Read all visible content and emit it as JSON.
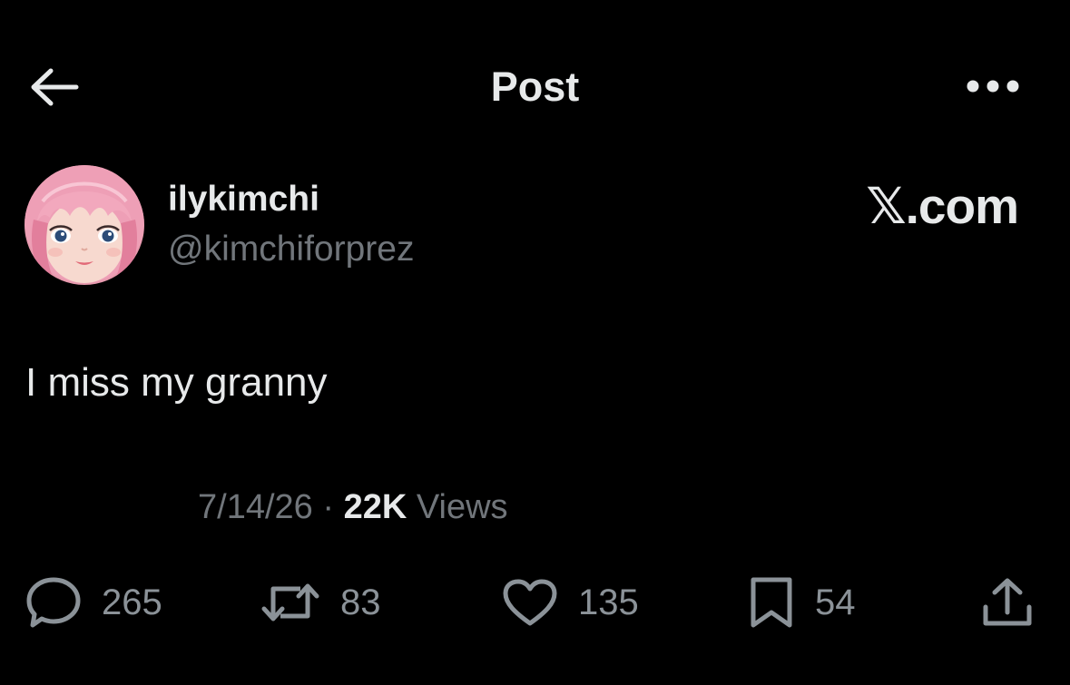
{
  "header": {
    "title": "Post",
    "back_icon": "arrow-left-icon",
    "more_icon": "more-horizontal-icon"
  },
  "author": {
    "display_name": "ilykimchi",
    "handle": "@kimchiforprez",
    "avatar_description_icon": "pink-doll-avatar"
  },
  "brand": "𝕏.com",
  "post": {
    "text": "I miss my granny",
    "date": "7/14/26",
    "separator": "·",
    "views_count": "22K",
    "views_label": "Views"
  },
  "actions": {
    "reply_count": "265",
    "repost_count": "83",
    "like_count": "135",
    "bookmark_count": "54"
  },
  "colors": {
    "background": "#000000",
    "primary_text": "#e7e9ea",
    "secondary_text": "#71767b",
    "avatar_hair": "#f0a0b8"
  }
}
